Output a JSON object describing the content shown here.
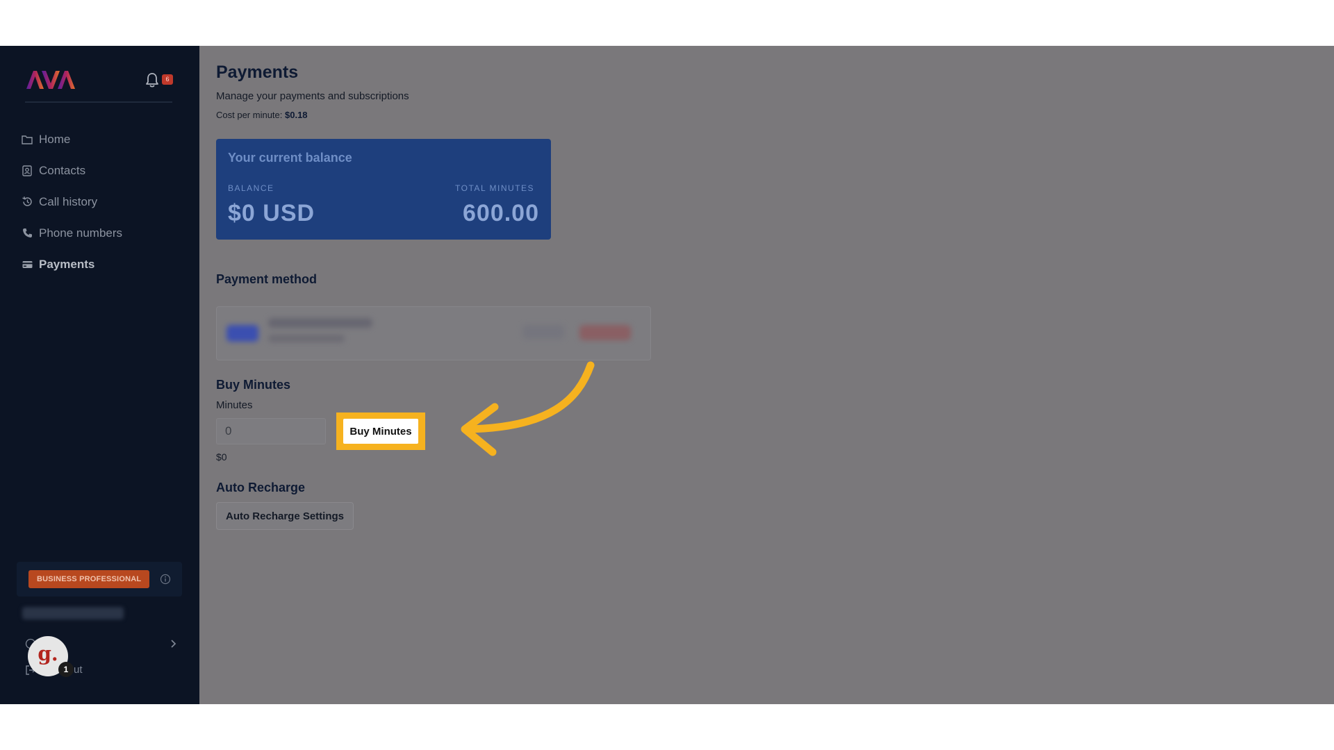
{
  "sidebar": {
    "logo_text": "AVA",
    "notifications_count": "6",
    "nav": [
      {
        "label": "Home",
        "icon": "folder-icon"
      },
      {
        "label": "Contacts",
        "icon": "contact-card-icon"
      },
      {
        "label": "Call history",
        "icon": "history-icon"
      },
      {
        "label": "Phone numbers",
        "icon": "phone-icon"
      },
      {
        "label": "Payments",
        "icon": "credit-card-icon",
        "active": true
      }
    ],
    "plan_badge": "BUSINESS PROFESSIONAL",
    "logout_partial": "ut",
    "avatar_letter": "g.",
    "avatar_count": "1"
  },
  "main": {
    "title": "Payments",
    "subtitle": "Manage your payments and subscriptions",
    "cost_label": "Cost per minute:",
    "cost_value": "$0.18",
    "balance_card": {
      "title": "Your current balance",
      "balance_label": "BALANCE",
      "balance_value": "$0 USD",
      "minutes_label": "TOTAL MINUTES",
      "minutes_value": "600.00"
    },
    "payment_method_heading": "Payment method",
    "buy_minutes": {
      "heading": "Buy Minutes",
      "field_label": "Minutes",
      "input_value": "0",
      "button_label": "Buy Minutes",
      "price": "$0"
    },
    "auto_recharge": {
      "heading": "Auto Recharge",
      "button_label": "Auto Recharge Settings"
    }
  },
  "colors": {
    "sidebar_bg": "#0c1424",
    "overlay": "#7a787b",
    "card_blue": "#1e3f7d",
    "highlight": "#f6b21f",
    "plan_badge": "#b8481f"
  }
}
